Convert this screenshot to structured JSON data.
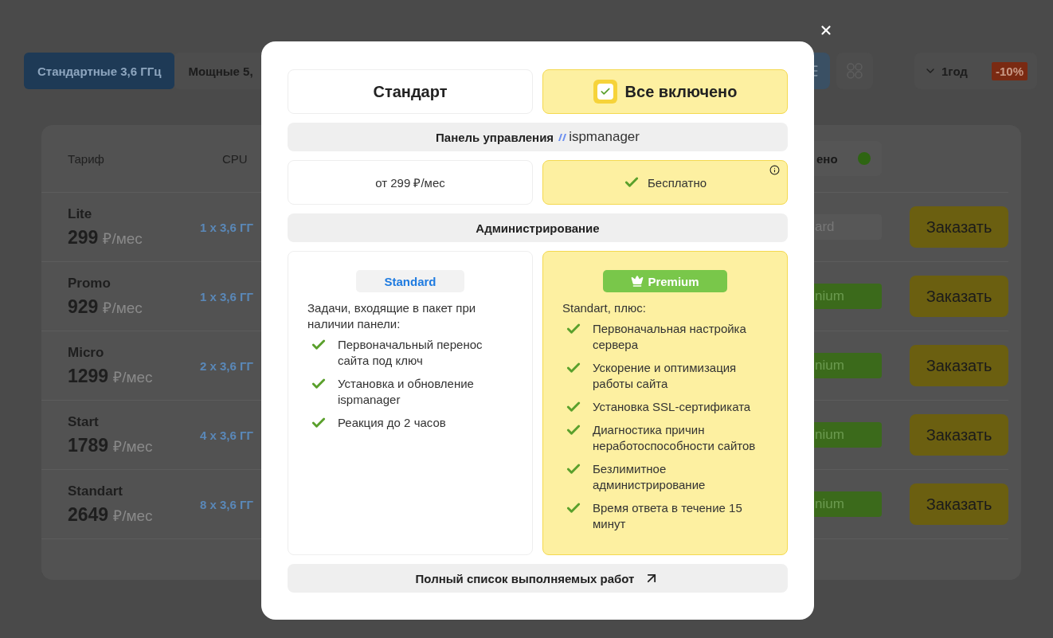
{
  "background": {
    "tabs": [
      {
        "label": "Стандартные 3,6 ГГц",
        "selected": true
      },
      {
        "label": "Мощные 5,",
        "selected": false
      }
    ],
    "view_toggle": [
      {
        "kind": "list",
        "selected": true
      },
      {
        "kind": "grid",
        "selected": false
      }
    ],
    "period": {
      "value": "1год",
      "discount": "-10%"
    },
    "table": {
      "columns": [
        "Тариф",
        "CPU",
        "ено"
      ],
      "rows": [
        {
          "name": "Lite",
          "price": "299",
          "unit": "₽/мес",
          "cpu": "1 x 3,6 ГГ",
          "admin": {
            "label": "ard",
            "kind": "standard"
          },
          "action": "Заказать"
        },
        {
          "name": "Promo",
          "price": "929",
          "unit": "₽/мес",
          "cpu": "1 x 3,6 ГГ",
          "admin": {
            "label": "nium",
            "kind": "premium"
          },
          "action": "Заказать"
        },
        {
          "name": "Micro",
          "price": "1299",
          "unit": "₽/мес",
          "cpu": "2 x 3,6 ГГ",
          "admin": {
            "label": "nium",
            "kind": "premium"
          },
          "action": "Заказать"
        },
        {
          "name": "Start",
          "price": "1789",
          "unit": "₽/мес",
          "cpu": "4 x 3,6 ГГ",
          "admin": {
            "label": "nium",
            "kind": "premium"
          },
          "action": "Заказать"
        },
        {
          "name": "Standart",
          "price": "2649",
          "unit": "₽/мес",
          "cpu": "8 x 3,6 ГГ",
          "admin": {
            "label": "nium",
            "kind": "premium"
          },
          "action": "Заказать"
        }
      ]
    }
  },
  "modal": {
    "plans": [
      {
        "label": "Стандарт",
        "selected": false
      },
      {
        "label": "Все включено",
        "selected": true
      }
    ],
    "panel_section": {
      "title": "Панель управления",
      "logo": "ispmanager"
    },
    "panel_prices": [
      {
        "text": "от 299 ₽/мес",
        "included": false
      },
      {
        "text": "Бесплатно",
        "included": true
      }
    ],
    "admin_section": {
      "title": "Администрирование"
    },
    "tiers": [
      {
        "badge": "Standard",
        "kind": "standard",
        "intro": "Задачи, входящие в пакет при наличии панели:",
        "items": [
          "Первоначальный перенос сайта под ключ",
          "Установка и обновление ispmanager",
          "Реакция до 2 часов"
        ]
      },
      {
        "badge": "Premium",
        "kind": "premium",
        "intro": "Standart, плюс:",
        "items": [
          "Первоначальная настройка сервера",
          "Ускорение и оптимизация работы сайта",
          "Установка SSL-сертификата",
          "Диагностика причин неработоспособности сайтов",
          "Безлимитное администрирование",
          "Время ответа в течение 15 минут"
        ]
      }
    ],
    "full_list_link": "Полный список выполняемых работ"
  }
}
